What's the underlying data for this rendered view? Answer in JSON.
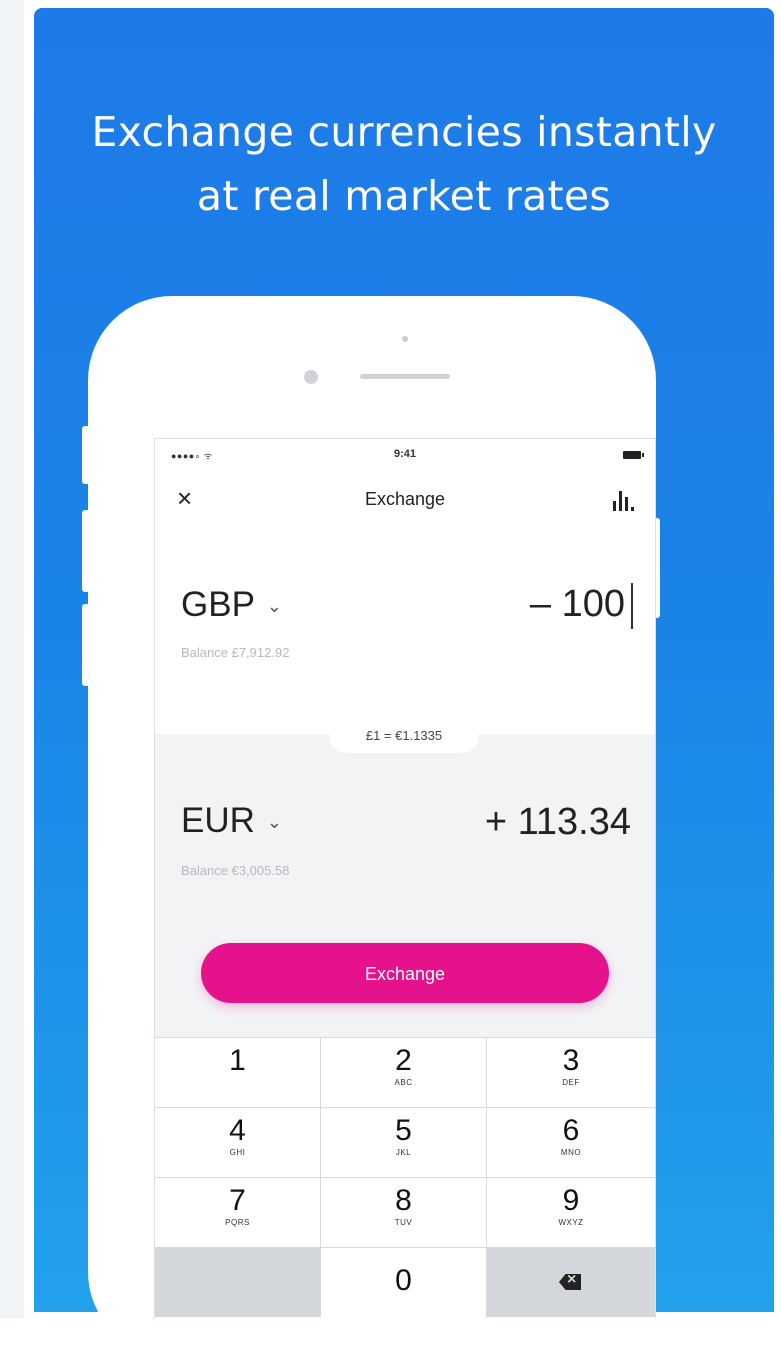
{
  "headline": {
    "line1": "Exchange currencies instantly",
    "line2": "at real market rates"
  },
  "status_bar": {
    "signal": "●●●●∘ ᯤ",
    "time": "9:41"
  },
  "nav": {
    "close_icon": "close-icon",
    "title": "Exchange",
    "chart_icon": "bar-chart-icon"
  },
  "from": {
    "currency": "GBP",
    "caret": "⌄",
    "amount": "– 100",
    "balance": "Balance £7,912.92"
  },
  "rate": "£1 = €1.1335",
  "to": {
    "currency": "EUR",
    "caret": "⌄",
    "amount": "+ 113.34",
    "balance": "Balance €3,005.58"
  },
  "exchange_button": "Exchange",
  "keypad": [
    {
      "num": "1",
      "letters": ""
    },
    {
      "num": "2",
      "letters": "ABC"
    },
    {
      "num": "3",
      "letters": "DEF"
    },
    {
      "num": "4",
      "letters": "GHI"
    },
    {
      "num": "5",
      "letters": "JKL"
    },
    {
      "num": "6",
      "letters": "MNO"
    },
    {
      "num": "7",
      "letters": "PQRS"
    },
    {
      "num": "8",
      "letters": "TUV"
    },
    {
      "num": "9",
      "letters": "WXYZ"
    },
    {
      "num": "0",
      "letters": ""
    }
  ],
  "colors": {
    "panel_blue": "#1f7ae9",
    "exchange_pink": "#e6128c"
  }
}
